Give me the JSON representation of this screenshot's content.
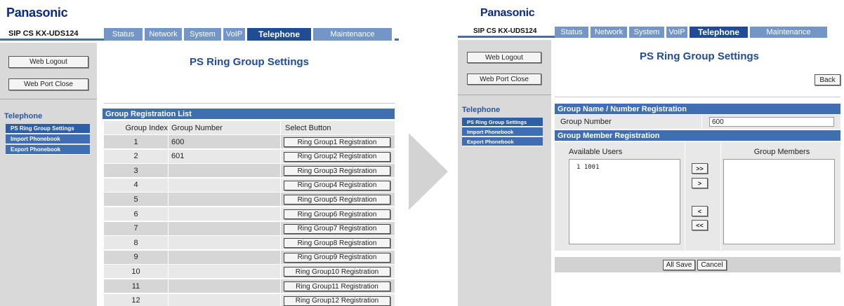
{
  "left": {
    "brand": "Panasonic",
    "model": "SIP CS KX-UDS124",
    "tabs": [
      {
        "label": "Status"
      },
      {
        "label": "Network"
      },
      {
        "label": "System"
      },
      {
        "label": "VoIP"
      },
      {
        "label": "Telephone"
      },
      {
        "label": "Maintenance"
      }
    ],
    "active_tab": "Telephone",
    "sidebar": {
      "logout_label": "Web Logout",
      "portclose_label": "Web Port Close",
      "section_title": "Telephone",
      "items": [
        {
          "label": "PS Ring Group Settings"
        },
        {
          "label": "Import Phonebook"
        },
        {
          "label": "Export Phonebook"
        }
      ]
    },
    "page_title": "PS Ring Group Settings",
    "list": {
      "header": "Group Registration List",
      "columns": [
        "Group Index",
        "Group Number",
        "Select Button"
      ],
      "rows": [
        {
          "index": "1",
          "number": "600",
          "button": "Ring Group1 Registration"
        },
        {
          "index": "2",
          "number": "601",
          "button": "Ring Group2 Registration"
        },
        {
          "index": "3",
          "number": "",
          "button": "Ring Group3 Registration"
        },
        {
          "index": "4",
          "number": "",
          "button": "Ring Group4 Registration"
        },
        {
          "index": "5",
          "number": "",
          "button": "Ring Group5 Registration"
        },
        {
          "index": "6",
          "number": "",
          "button": "Ring Group6 Registration"
        },
        {
          "index": "7",
          "number": "",
          "button": "Ring Group7 Registration"
        },
        {
          "index": "8",
          "number": "",
          "button": "Ring Group8 Registration"
        },
        {
          "index": "9",
          "number": "",
          "button": "Ring Group9 Registration"
        },
        {
          "index": "10",
          "number": "",
          "button": "Ring Group10 Registration"
        },
        {
          "index": "11",
          "number": "",
          "button": "Ring Group11 Registration"
        },
        {
          "index": "12",
          "number": "",
          "button": "Ring Group12 Registration"
        }
      ]
    }
  },
  "right": {
    "brand": "Panasonic",
    "model": "SIP CS KX-UDS124",
    "tabs": [
      {
        "label": "Status"
      },
      {
        "label": "Network"
      },
      {
        "label": "System"
      },
      {
        "label": "VoIP"
      },
      {
        "label": "Telephone"
      },
      {
        "label": "Maintenance"
      }
    ],
    "active_tab": "Telephone",
    "sidebar": {
      "logout_label": "Web Logout",
      "portclose_label": "Web Port Close",
      "section_title": "Telephone",
      "items": [
        {
          "label": "PS Ring Group Settings"
        },
        {
          "label": "Import Phonebook"
        },
        {
          "label": "Export Phonebook"
        }
      ]
    },
    "page_title": "PS Ring Group Settings",
    "back_label": "Back",
    "name_section": {
      "header": "Group Name / Number Registration",
      "field_label": "Group Number",
      "field_value": "600"
    },
    "member_section": {
      "header": "Group Member Registration",
      "available_label": "Available Users",
      "members_label": "Group Members",
      "available_users": [
        "1 1001"
      ],
      "group_members": [],
      "move_all_right": ">>",
      "move_right": ">",
      "move_left": "<",
      "move_all_left": "<<"
    },
    "all_save_label": "All Save",
    "cancel_label": "Cancel"
  },
  "colors": {
    "brand": "#0a2a8a",
    "tab": "#7396c6",
    "tab_active": "#1f4c95",
    "section": "#3f6fb2",
    "sidebar": "#d9d9d9",
    "row_odd": "#d6d6d6",
    "row_even": "#e8e8e8"
  },
  "icons": {
    "transition": "play-arrow-icon"
  }
}
